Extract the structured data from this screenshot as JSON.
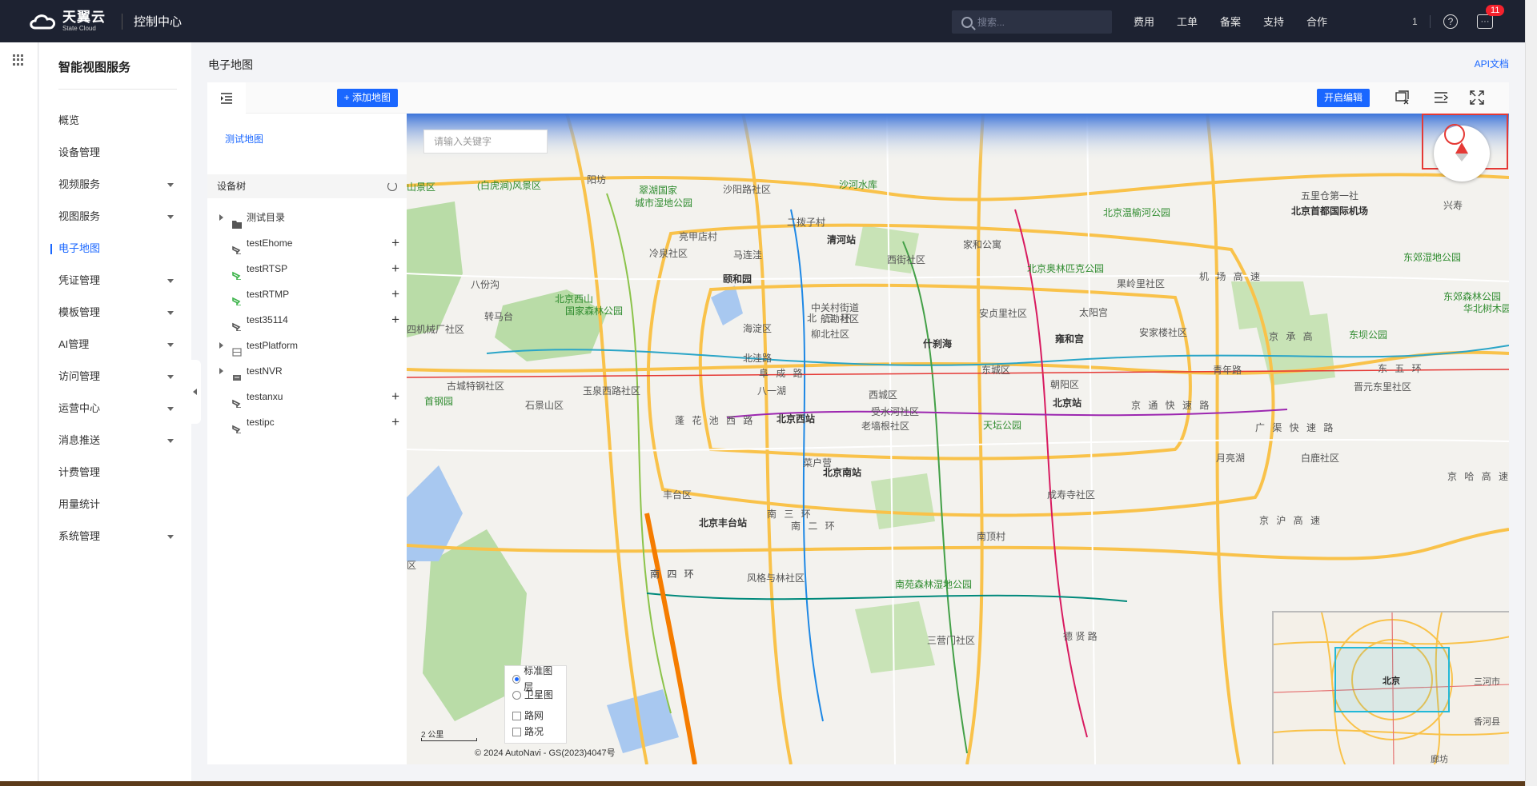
{
  "topbar": {
    "brand_cn": "天翼云",
    "brand_en": "State Cloud",
    "console": "控制中心",
    "search_placeholder": "搜索...",
    "nav": [
      "费用",
      "工单",
      "备案",
      "支持",
      "合作"
    ],
    "user_glyph": "1",
    "help_glyph": "?",
    "message_badge": "11"
  },
  "sidebar": {
    "title": "智能视图服务",
    "items": [
      {
        "label": "概览",
        "expandable": false
      },
      {
        "label": "设备管理",
        "expandable": false
      },
      {
        "label": "视频服务",
        "expandable": true
      },
      {
        "label": "视图服务",
        "expandable": true
      },
      {
        "label": "电子地图",
        "expandable": false,
        "active": true
      },
      {
        "label": "凭证管理",
        "expandable": true
      },
      {
        "label": "模板管理",
        "expandable": true
      },
      {
        "label": "AI管理",
        "expandable": true
      },
      {
        "label": "访问管理",
        "expandable": true
      },
      {
        "label": "运营中心",
        "expandable": true
      },
      {
        "label": "消息推送",
        "expandable": true
      },
      {
        "label": "计费管理",
        "expandable": false
      },
      {
        "label": "用量统计",
        "expandable": false
      },
      {
        "label": "系统管理",
        "expandable": true
      }
    ]
  },
  "page": {
    "title": "电子地图",
    "api_link": "API文档"
  },
  "panel": {
    "add_map_label": "+ 添加地图",
    "map_item": "测试地图",
    "tree_header": "设备树",
    "tree": [
      {
        "label": "测试目录",
        "type": "folder",
        "expand": true,
        "plus": false
      },
      {
        "label": "testEhome",
        "type": "camera",
        "expand": false,
        "plus": true
      },
      {
        "label": "testRTSP",
        "type": "camera-green",
        "expand": false,
        "plus": true
      },
      {
        "label": "testRTMP",
        "type": "camera-green",
        "expand": false,
        "plus": true
      },
      {
        "label": "test35114",
        "type": "camera",
        "expand": false,
        "plus": true
      },
      {
        "label": "testPlatform",
        "type": "platform",
        "expand": true,
        "plus": false
      },
      {
        "label": "testNVR",
        "type": "nvr",
        "expand": true,
        "plus": false
      },
      {
        "label": "testanxu",
        "type": "camera",
        "expand": false,
        "plus": true
      },
      {
        "label": "testipc",
        "type": "camera",
        "expand": false,
        "plus": true
      }
    ]
  },
  "map": {
    "edit_label": "开启编辑",
    "search_placeholder": "请输入关键字",
    "layers": {
      "standard": "标准图层",
      "satellite": "卫星图",
      "roadnet": "路网",
      "traffic": "路况"
    },
    "scale": "2 公里",
    "copyright": "© 2024 AutoNavi - GS(2023)4047号",
    "overview_labels": {
      "city": "北京",
      "sanhe": "三河市",
      "xianghe": "香河县",
      "langfang": "廊坊"
    },
    "labels": [
      {
        "t": "沙河水库",
        "c": "green"
      },
      {
        "t": "翠湖国家",
        "c": "green"
      },
      {
        "t": "城市湿地公园",
        "c": "green"
      },
      {
        "t": "沙阳路社区",
        "c": ""
      },
      {
        "t": "阳坊",
        "c": ""
      },
      {
        "t": "(白虎涧)风景区",
        "c": "green"
      },
      {
        "t": "山景区",
        "c": "green"
      },
      {
        "t": "北京温榆河公园",
        "c": "green"
      },
      {
        "t": "北京首都国际机场",
        "c": "bold"
      },
      {
        "t": "五里仓第一社",
        "c": ""
      },
      {
        "t": "兴寿",
        "c": ""
      },
      {
        "t": "清河站",
        "c": "bold"
      },
      {
        "t": "亮甲店村",
        "c": ""
      },
      {
        "t": "马连洼",
        "c": ""
      },
      {
        "t": "冷泉社区",
        "c": ""
      },
      {
        "t": "颐和园",
        "c": "bold"
      },
      {
        "t": "北京奥林匹克公园",
        "c": "green"
      },
      {
        "t": "西街社区",
        "c": ""
      },
      {
        "t": "东郊湿地公园",
        "c": "green"
      },
      {
        "t": "八份沟",
        "c": ""
      },
      {
        "t": "北京西山",
        "c": "green"
      },
      {
        "t": "国家森林公园",
        "c": "green"
      },
      {
        "t": "中关村街道",
        "c": ""
      },
      {
        "t": "航勘社区",
        "c": ""
      },
      {
        "t": "北 三 环",
        "c": "road"
      },
      {
        "t": "安贞里社区",
        "c": ""
      },
      {
        "t": "太阳宫",
        "c": ""
      },
      {
        "t": "果岭里社区",
        "c": ""
      },
      {
        "t": "东郊森林公园",
        "c": "green"
      },
      {
        "t": "华北树木园",
        "c": "green"
      },
      {
        "t": "转马台",
        "c": ""
      },
      {
        "t": "四机械厂社区",
        "c": ""
      },
      {
        "t": "海淀区",
        "c": ""
      },
      {
        "t": "柳北社区",
        "c": ""
      },
      {
        "t": "什刹海",
        "c": "bold"
      },
      {
        "t": "雍和宫",
        "c": "bold"
      },
      {
        "t": "安家楼社区",
        "c": ""
      },
      {
        "t": "东坝公园",
        "c": "green"
      },
      {
        "t": "北洼路",
        "c": ""
      },
      {
        "t": "阜 成 路",
        "c": "road"
      },
      {
        "t": "东城区",
        "c": ""
      },
      {
        "t": "青年路",
        "c": ""
      },
      {
        "t": "古城特钢社区",
        "c": ""
      },
      {
        "t": "玉泉西路社区",
        "c": ""
      },
      {
        "t": "八一湖",
        "c": ""
      },
      {
        "t": "西城区",
        "c": ""
      },
      {
        "t": "朝阳区",
        "c": ""
      },
      {
        "t": "晋元东里社区",
        "c": ""
      },
      {
        "t": "首钢园",
        "c": "green"
      },
      {
        "t": "石景山区",
        "c": ""
      },
      {
        "t": "北京西站",
        "c": "bold"
      },
      {
        "t": "受水河社区",
        "c": ""
      },
      {
        "t": "北京站",
        "c": "bold"
      },
      {
        "t": "京 通 快 速 路",
        "c": "road"
      },
      {
        "t": "蓬 花 池 西 路",
        "c": "road"
      },
      {
        "t": "老墙根社区",
        "c": ""
      },
      {
        "t": "天坛公园",
        "c": "green"
      },
      {
        "t": "广 渠 快 速 路",
        "c": "road"
      },
      {
        "t": "月亮湖",
        "c": ""
      },
      {
        "t": "白鹿社区",
        "c": ""
      },
      {
        "t": "菜户营",
        "c": ""
      },
      {
        "t": "北京南站",
        "c": "bold"
      },
      {
        "t": "京 哈 高 速",
        "c": "road"
      },
      {
        "t": "丰台区",
        "c": ""
      },
      {
        "t": "南 三 环",
        "c": "road"
      },
      {
        "t": "成寿寺社区",
        "c": ""
      },
      {
        "t": "北京丰台站",
        "c": "bold"
      },
      {
        "t": "南 二 环",
        "c": "road"
      },
      {
        "t": "南顶村",
        "c": ""
      },
      {
        "t": "南 四 环",
        "c": "road"
      },
      {
        "t": "南 四 环",
        "c": "road"
      },
      {
        "t": "风格与林社区",
        "c": ""
      },
      {
        "t": "南苑森林湿地公园",
        "c": "green"
      },
      {
        "t": "三营门社区",
        "c": ""
      },
      {
        "t": "德 贤 路",
        "c": ""
      },
      {
        "t": "机 场 高 速",
        "c": "road"
      },
      {
        "t": "京 承 高",
        "c": "road"
      },
      {
        "t": "东 五 环",
        "c": "road"
      },
      {
        "t": "京 沪 高 速",
        "c": "road"
      },
      {
        "t": "家和公寓",
        "c": ""
      },
      {
        "t": "二拨子村",
        "c": ""
      },
      {
        "t": "区",
        "c": ""
      }
    ]
  },
  "colors": {
    "primary": "#1a67ff",
    "topbar": "#1d2231",
    "highlight_red": "#e53935"
  }
}
